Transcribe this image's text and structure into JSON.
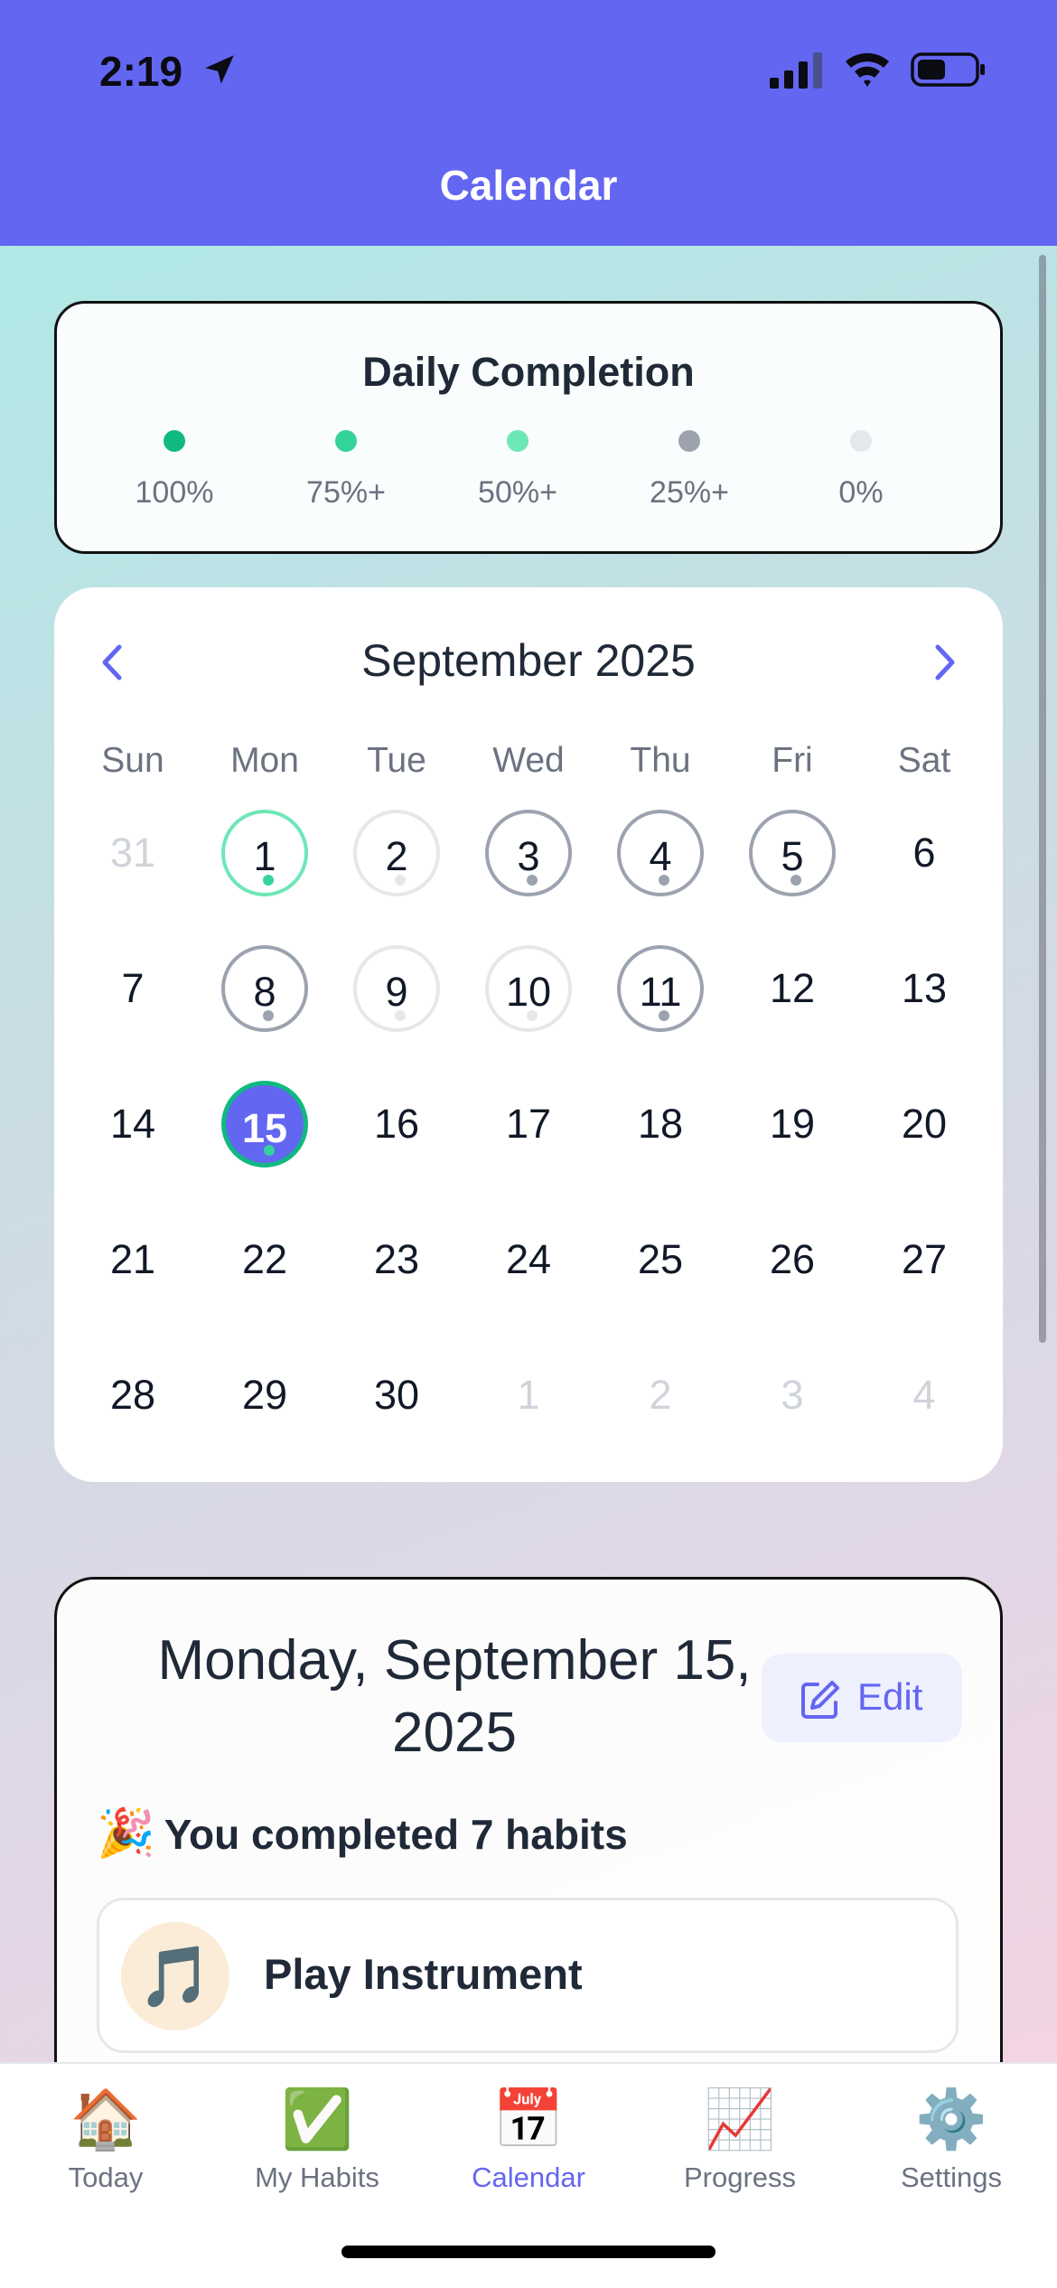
{
  "status_bar": {
    "time": "2:19"
  },
  "header": {
    "title": "Calendar"
  },
  "legend": {
    "title": "Daily Completion",
    "items": [
      {
        "label": "100%",
        "color": "#10b981"
      },
      {
        "label": "75%+",
        "color": "#34d399"
      },
      {
        "label": "50%+",
        "color": "#6ee7b7"
      },
      {
        "label": "25%+",
        "color": "#9ca3af"
      },
      {
        "label": "0%",
        "color": "#e5e7eb"
      }
    ]
  },
  "calendar": {
    "month_label": "September 2025",
    "weekdays": [
      "Sun",
      "Mon",
      "Tue",
      "Wed",
      "Thu",
      "Fri",
      "Sat"
    ],
    "weeks": [
      [
        {
          "label": "31",
          "outside": true
        },
        {
          "label": "1",
          "level": "100"
        },
        {
          "label": "2",
          "level": "0"
        },
        {
          "label": "3",
          "level": "25"
        },
        {
          "label": "4",
          "level": "25"
        },
        {
          "label": "5",
          "level": "25"
        },
        {
          "label": "6"
        }
      ],
      [
        {
          "label": "7"
        },
        {
          "label": "8",
          "level": "25"
        },
        {
          "label": "9",
          "level": "0"
        },
        {
          "label": "10",
          "level": "0"
        },
        {
          "label": "11",
          "level": "25"
        },
        {
          "label": "12"
        },
        {
          "label": "13"
        }
      ],
      [
        {
          "label": "14"
        },
        {
          "label": "15",
          "selected": true,
          "level": "100"
        },
        {
          "label": "16"
        },
        {
          "label": "17"
        },
        {
          "label": "18"
        },
        {
          "label": "19"
        },
        {
          "label": "20"
        }
      ],
      [
        {
          "label": "21"
        },
        {
          "label": "22"
        },
        {
          "label": "23"
        },
        {
          "label": "24"
        },
        {
          "label": "25"
        },
        {
          "label": "26"
        },
        {
          "label": "27"
        }
      ],
      [
        {
          "label": "28"
        },
        {
          "label": "29"
        },
        {
          "label": "30"
        },
        {
          "label": "1",
          "outside": true
        },
        {
          "label": "2",
          "outside": true
        },
        {
          "label": "3",
          "outside": true
        },
        {
          "label": "4",
          "outside": true
        }
      ]
    ]
  },
  "detail": {
    "date_line1": "Monday, September 15,",
    "date_line2": "2025",
    "edit_label": "Edit",
    "summary_emoji": "🎉",
    "summary": "You completed 7 habits",
    "habits": [
      {
        "emoji": "🎵",
        "name": "Play Instrument"
      }
    ]
  },
  "tabbar": {
    "tabs": [
      {
        "label": "Today",
        "emoji": "🏠",
        "icon": "home-icon"
      },
      {
        "label": "My Habits",
        "emoji": "✅",
        "icon": "checkmark-icon"
      },
      {
        "label": "Calendar",
        "emoji": "📅",
        "icon": "calendar-icon",
        "active": true
      },
      {
        "label": "Progress",
        "emoji": "📈",
        "icon": "chart-icon"
      },
      {
        "label": "Settings",
        "emoji": "⚙️",
        "icon": "gear-icon"
      }
    ]
  }
}
